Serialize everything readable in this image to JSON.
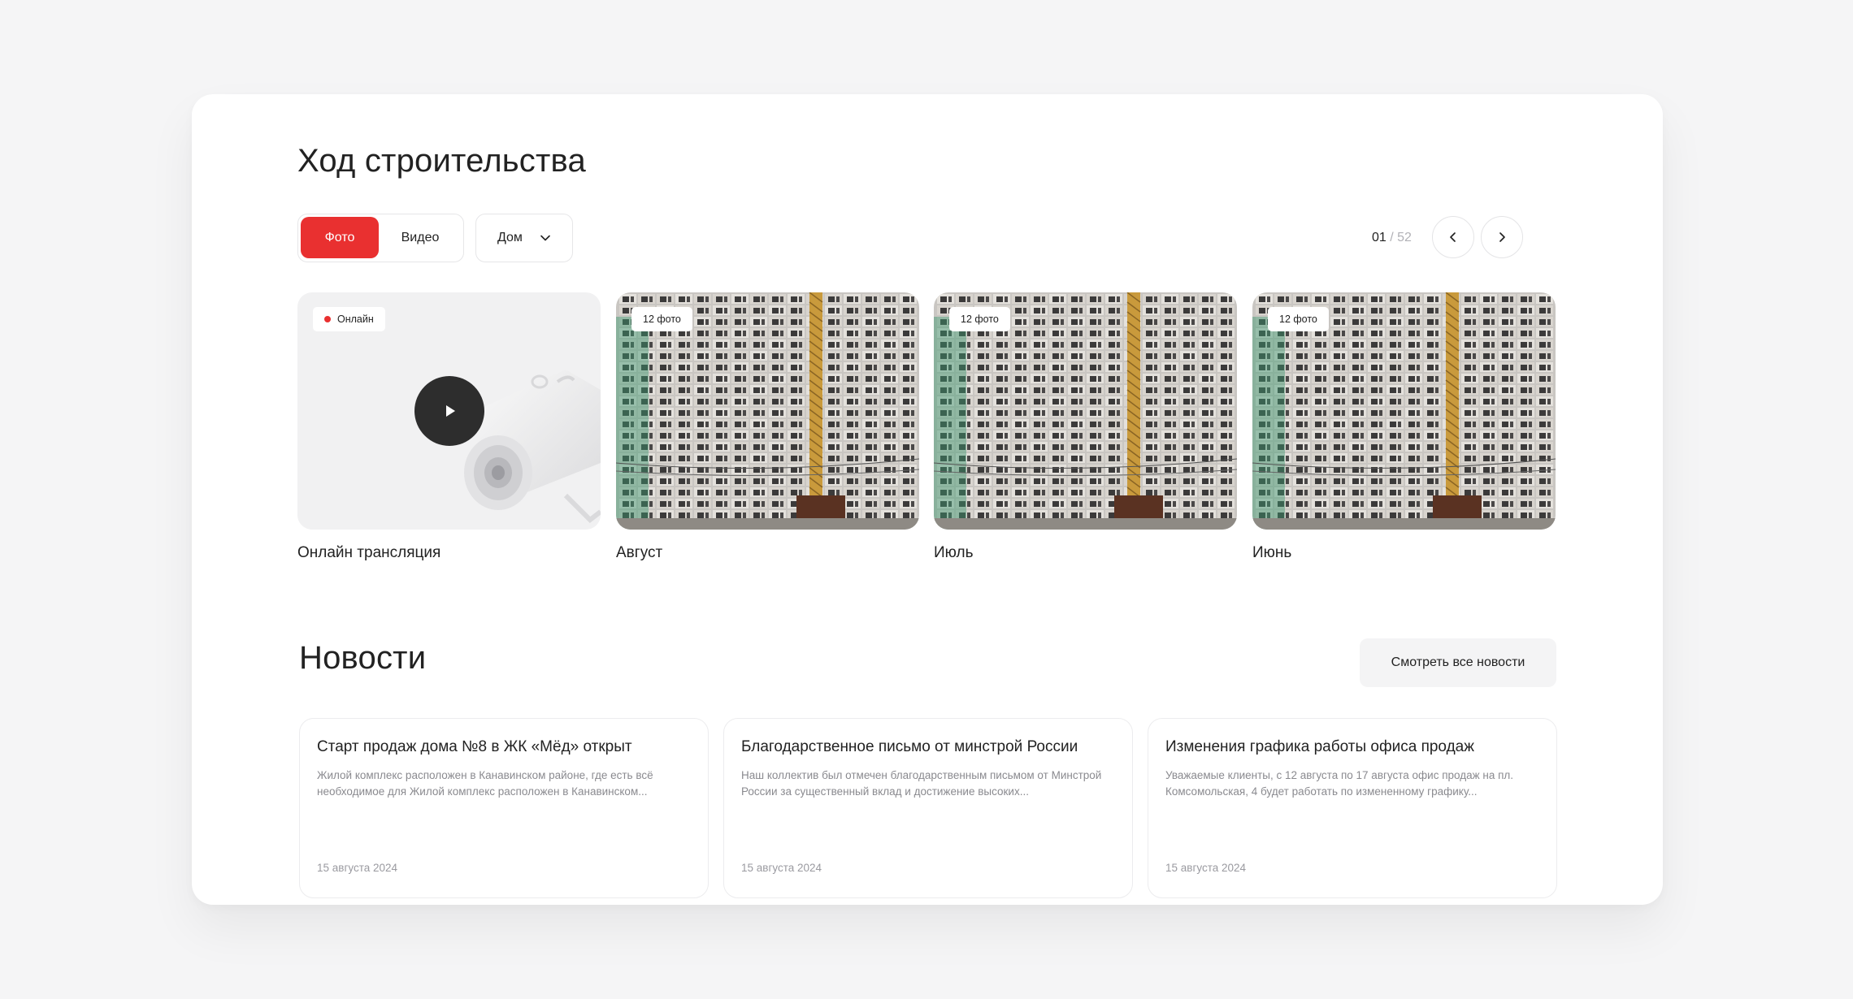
{
  "progress": {
    "title": "Ход строительства",
    "tabs": {
      "photo": "Фото",
      "video": "Видео"
    },
    "house_select": "Дом",
    "pager": {
      "current": "01",
      "separator": " / ",
      "total": "52"
    },
    "tiles": [
      {
        "caption": "Онлайн трансляция",
        "badge": "Онлайн"
      },
      {
        "caption": "Август",
        "badge": "12 фото"
      },
      {
        "caption": "Июль",
        "badge": "12 фото"
      },
      {
        "caption": "Июнь",
        "badge": "12 фото"
      }
    ]
  },
  "news": {
    "title": "Новости",
    "all_button": "Смотреть все новости",
    "items": [
      {
        "title": "Старт продаж дома №8 в ЖК «Мёд» открыт",
        "desc": "Жилой комплекс расположен в Канавинском районе, где есть всё необходимое для Жилой комплекс расположен в Канавинском...",
        "date": "15 августа 2024"
      },
      {
        "title": "Благодарственное письмо от минстрой России",
        "desc": "Наш коллектив был отмечен благодарственным письмом от Минстрой России за существенный вклад и достижение высоких...",
        "date": "15 августа 2024"
      },
      {
        "title": "Изменения графика работы офиса продаж",
        "desc": "Уважаемые клиенты, с 12 августа по 17 августа офис продаж на пл. Комсомольская, 4 будет работать по измененному графику...",
        "date": "15 августа 2024"
      }
    ]
  },
  "colors": {
    "accent": "#e93030",
    "background": "#f5f5f6",
    "card": "#ffffff",
    "muted": "#8a8a8f"
  },
  "icons": [
    "chevron-down-icon",
    "chevron-left-icon",
    "chevron-right-icon",
    "play-icon",
    "live-dot-icon",
    "camera-illustration"
  ]
}
